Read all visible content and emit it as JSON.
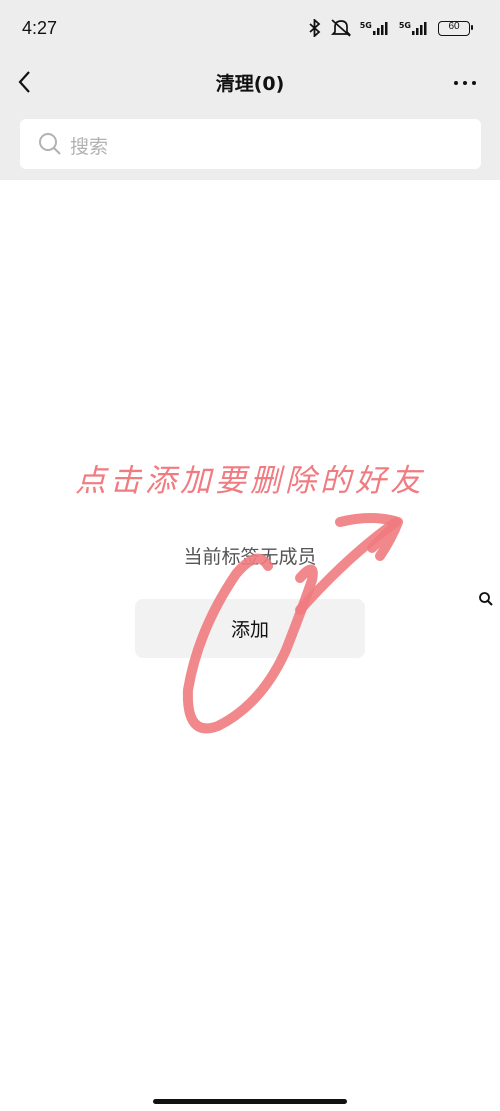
{
  "status_bar": {
    "time": "4:27",
    "signal_1_label": "5G",
    "signal_2_label": "5G",
    "battery_level": "60"
  },
  "nav": {
    "title": "清理(0)",
    "back_icon": "chevron-left-icon",
    "more_icon": "more-dots-icon"
  },
  "search": {
    "placeholder": "搜索",
    "icon": "search-icon"
  },
  "content": {
    "empty_message": "当前标签无成员",
    "add_button_label": "添加"
  },
  "annotation": {
    "text": "点击添加要删除的好友",
    "color": "#f07b80"
  }
}
